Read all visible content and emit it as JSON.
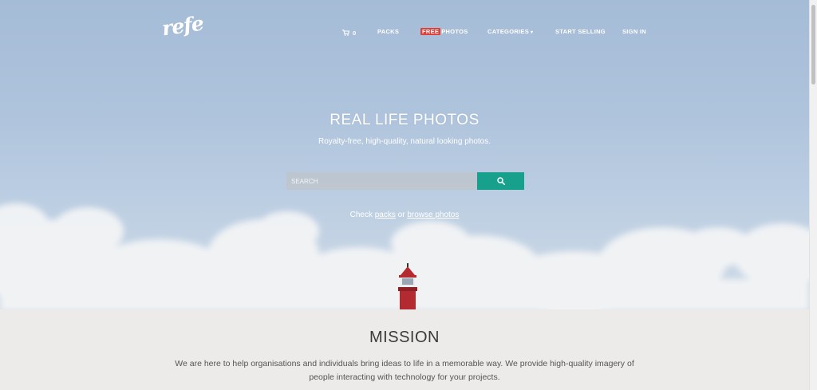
{
  "logo": "refe",
  "nav": {
    "cart_count": "0",
    "packs": "PACKS",
    "free_badge": "FREE",
    "photos": "PHOTOS",
    "categories": "CATEGORIES",
    "start_selling": "START SELLING",
    "sign_in": "SIGN IN"
  },
  "hero": {
    "title": "REAL LIFE PHOTOS",
    "subtitle": "Royalty-free, high-quality, natural looking photos.",
    "search_placeholder": "SEARCH",
    "check_prefix": "Check ",
    "packs_link": "packs",
    "or_text": " or ",
    "browse_link": "browse photos"
  },
  "mission": {
    "title": "MISSION",
    "text": "We are here to help organisations and individuals bring ideas to life in a memorable way. We provide high-quality imagery of people interacting with technology for your projects."
  },
  "colors": {
    "accent": "#17a08c",
    "free_badge": "#e0403a",
    "lighthouse_red": "#b32b31"
  },
  "icons": [
    "cart-icon",
    "search-icon",
    "chevron-down-icon"
  ]
}
